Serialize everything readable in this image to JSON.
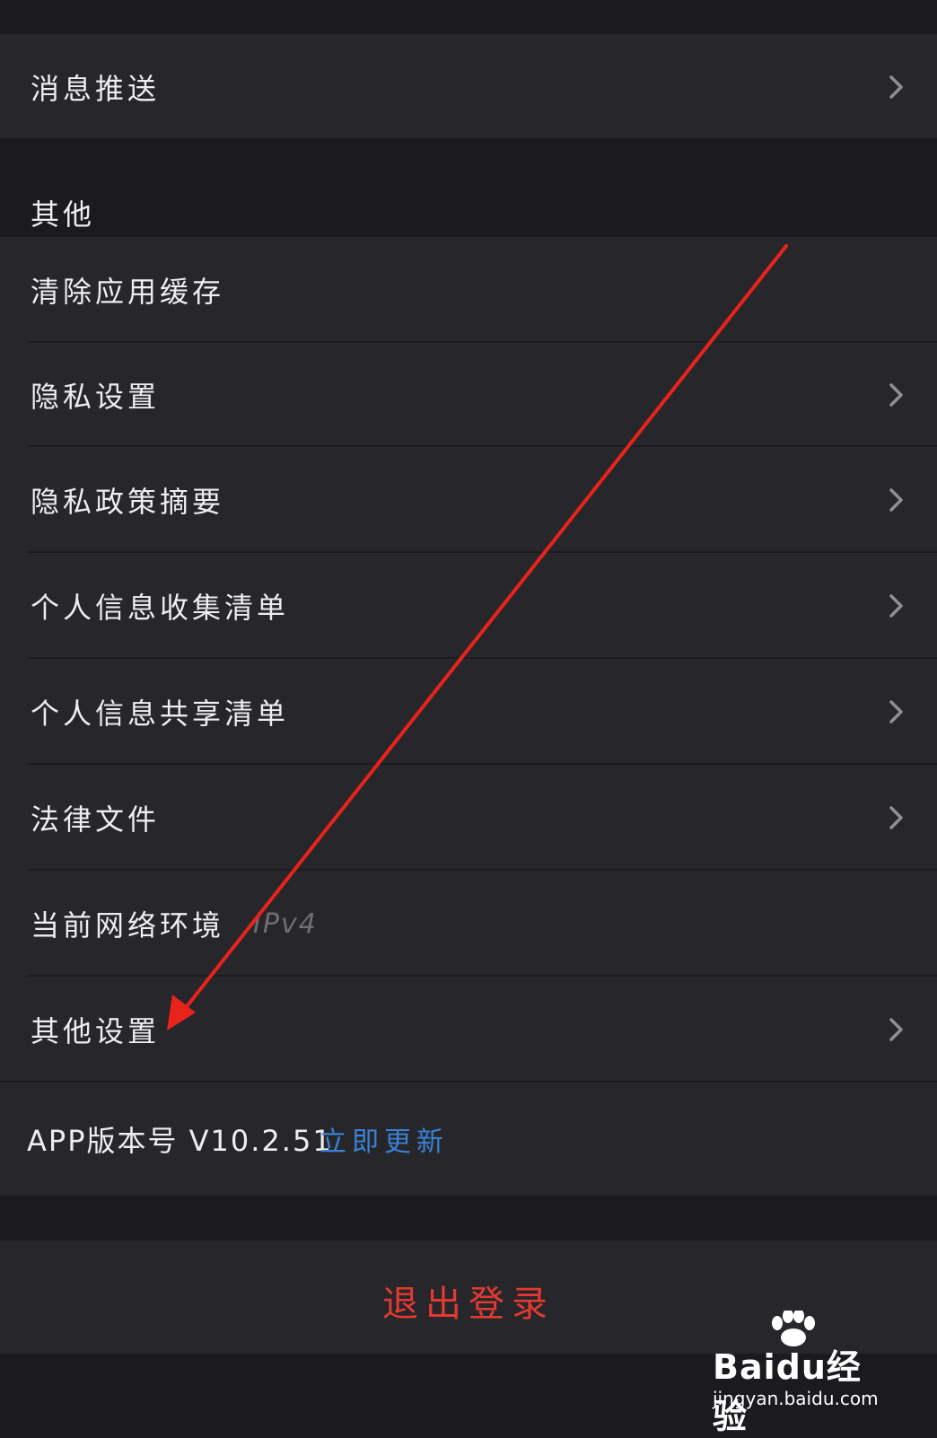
{
  "rows": {
    "push": {
      "label": "消息推送"
    },
    "other_header": "其他",
    "clear_cache": {
      "label": "清除应用缓存"
    },
    "privacy_settings": {
      "label": "隐私设置"
    },
    "privacy_policy": {
      "label": "隐私政策摘要"
    },
    "info_collection": {
      "label": "个人信息收集清单"
    },
    "info_sharing": {
      "label": "个人信息共享清单"
    },
    "legal_docs": {
      "label": "法律文件"
    },
    "network_env": {
      "label": "当前网络环境",
      "value": "IPv4"
    },
    "other_settings": {
      "label": "其他设置"
    },
    "version": {
      "label": "APP版本号 V10.2.51",
      "update_label": "立即更新"
    }
  },
  "logout": {
    "label": "退出登录"
  },
  "watermark": {
    "brand": "Baidu经验",
    "url": "jingyan.baidu.com"
  },
  "colors": {
    "background": "#1b1b1f",
    "row": "#26262b",
    "text": "#eeeeee",
    "muted": "#6d6d72",
    "link": "#3a82d6",
    "danger": "#e23a32",
    "annotation_arrow": "#e8231c"
  },
  "icons": {
    "chevron": "chevron-right-icon",
    "annotation": "red-arrow-annotation"
  }
}
